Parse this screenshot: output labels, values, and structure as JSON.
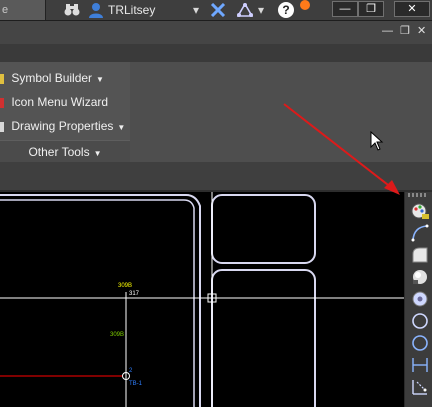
{
  "titlebar": {
    "tab_stub": "e",
    "user_name": "TRLitsey",
    "minimize": "—",
    "restore": "❐",
    "close": "✕"
  },
  "ribbon": {
    "window_controls": "— ❐ ✕",
    "items": [
      {
        "label": "Symbol Builder"
      },
      {
        "label": "Icon Menu  Wizard"
      },
      {
        "label": "Drawing  Properties"
      }
    ],
    "other_tools": "Other Tools"
  },
  "drawing": {
    "labels": {
      "wire_top": "309B",
      "node_top": "317",
      "wire_mid": "309B",
      "node_num": "2",
      "terminal": "TB-1"
    },
    "colors": {
      "label_yellow": "#ffff00",
      "label_green": "#7fd000",
      "label_blue": "#2f7fff",
      "red_line": "#ff0000",
      "arrow": "#dd1a1a"
    }
  },
  "toolbar_right": {
    "icons": [
      "palette-icon",
      "arc-icon",
      "quarter-fill-icon",
      "sphere-icon",
      "circle-dot-icon",
      "circle-icon",
      "circle-outline-icon",
      "dimension-icon",
      "dimension-angle-icon"
    ]
  }
}
